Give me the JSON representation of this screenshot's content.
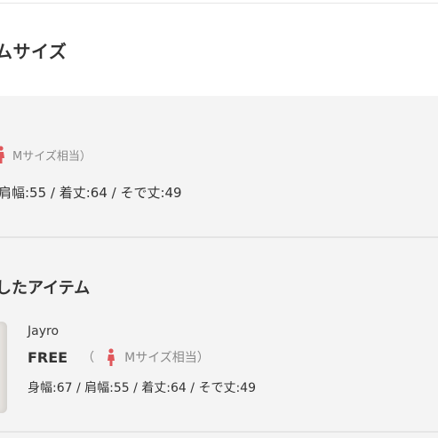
{
  "header": {
    "title": "ムサイズ"
  },
  "size_ref": {
    "hint": "Mサイズ相当）",
    "measurements": "肩幅:55 / 着丈:64 / そで丈:49"
  },
  "related": {
    "title": "したアイテム",
    "item": {
      "brand": "Jayro",
      "size": "FREE",
      "paren_open": "（",
      "hint": "Mサイズ相当）",
      "measurements": "身幅:67 / 肩幅:55 / 着丈:64 / そで丈:49"
    }
  },
  "colors": {
    "person_icon": "#e0575b",
    "muted_text": "#8a8a8a"
  }
}
